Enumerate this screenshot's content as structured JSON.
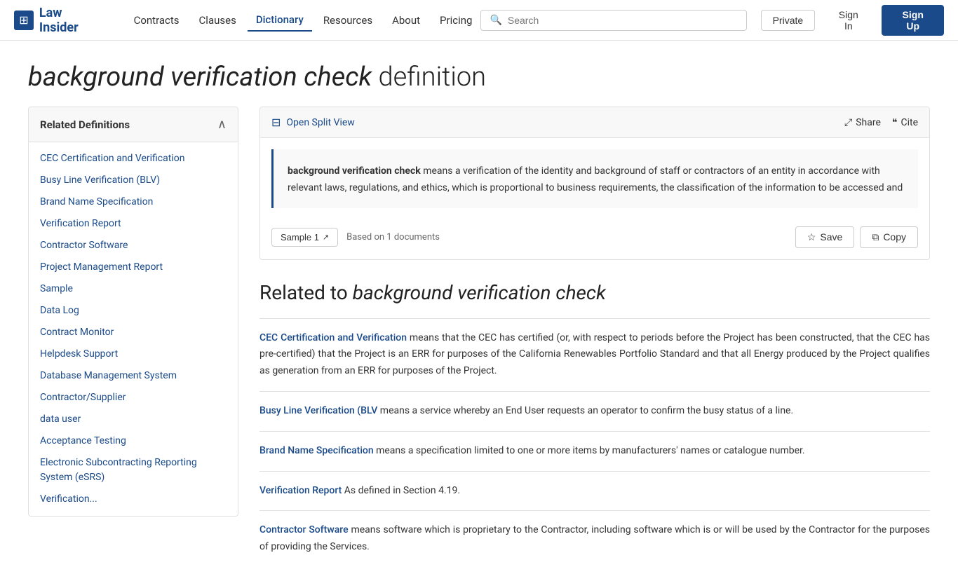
{
  "header": {
    "logo_text": "Law Insider",
    "logo_icon": "⊞",
    "nav_items": [
      {
        "label": "Contracts",
        "active": false
      },
      {
        "label": "Clauses",
        "active": false
      },
      {
        "label": "Dictionary",
        "active": true
      },
      {
        "label": "Resources",
        "active": false
      },
      {
        "label": "About",
        "active": false
      },
      {
        "label": "Pricing",
        "active": false
      }
    ],
    "search_placeholder": "Search",
    "btn_private": "Private",
    "btn_signin": "Sign In",
    "btn_signup": "Sign Up"
  },
  "page": {
    "title_italic": "background verification check",
    "title_suffix": " definition"
  },
  "sidebar": {
    "title": "Related Definitions",
    "items": [
      {
        "label": "CEC Certification and Verification"
      },
      {
        "label": "Busy Line Verification (BLV)"
      },
      {
        "label": "Brand Name Specification"
      },
      {
        "label": "Verification Report"
      },
      {
        "label": "Contractor Software"
      },
      {
        "label": "Project Management Report"
      },
      {
        "label": "Sample"
      },
      {
        "label": "Data Log"
      },
      {
        "label": "Contract Monitor"
      },
      {
        "label": "Helpdesk Support"
      },
      {
        "label": "Database Management System"
      },
      {
        "label": "Contractor/Supplier"
      },
      {
        "label": "data user"
      },
      {
        "label": "Acceptance Testing"
      },
      {
        "label": "Electronic Subcontracting Reporting System (eSRS)"
      },
      {
        "label": "Verification..."
      }
    ]
  },
  "definition_card": {
    "open_split_label": "Open Split View",
    "share_label": "Share",
    "cite_label": "Cite",
    "definition_bold": "background verification check",
    "definition_text": " means a verification of the identity and background of staff or contractors of an entity in accordance with relevant laws, regulations, and ethics, which is proportional to business requirements, the classification of the information to be accessed and",
    "sample_btn": "Sample 1",
    "based_on": "Based on 1 documents",
    "save_btn": "Save",
    "copy_btn": "Copy"
  },
  "related_section": {
    "title_prefix": "Related to ",
    "title_italic": "background verification check",
    "items": [
      {
        "link_text": "CEC Certification and Verification",
        "text": " means that the CEC has certified (or, with respect to periods before the Project has been constructed, that the CEC has pre-certified) that the Project is an ERR for purposes of the California Renewables Portfolio Standard and that all Energy produced by the Project qualifies as generation from an ERR for purposes of the Project."
      },
      {
        "link_text": "Busy Line Verification (BLV",
        "text": " means a service whereby an End User requests an operator to confirm the busy status of a line."
      },
      {
        "link_text": "Brand Name Specification",
        "text": " means a specification limited to one or more items by manufacturers' names or catalogue number."
      },
      {
        "link_text": "Verification Report",
        "text": " As defined in Section 4.19."
      },
      {
        "link_text": "Contractor Software",
        "text": " means software which is proprietary to the Contractor, including software which is or will be used by the Contractor for the purposes of providing the Services."
      }
    ]
  }
}
